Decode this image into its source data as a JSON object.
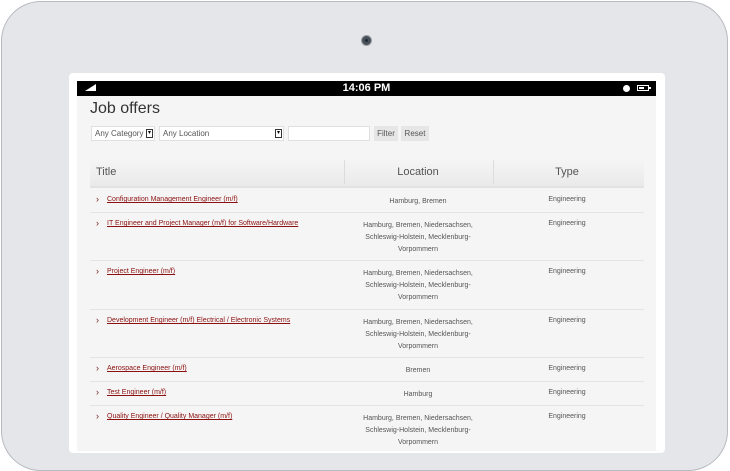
{
  "status_bar": {
    "time": "14:06 PM",
    "icons": [
      "signal-icon",
      "clock-icon",
      "battery-icon"
    ]
  },
  "page": {
    "title": "Job offers"
  },
  "filters": {
    "category_selected": "Any Category",
    "location_selected": "Any Location",
    "search_value": "",
    "filter_label": "Filter",
    "reset_label": "Reset"
  },
  "table": {
    "headers": {
      "title": "Title",
      "location": "Location",
      "type": "Type"
    },
    "rows": [
      {
        "title": "Configuration Management Engineer (m/f)",
        "location": "Hamburg, Bremen",
        "type": "Engineering"
      },
      {
        "title": "IT Engineer and Project Manager (m/f) for Software/Hardware",
        "location": "Hamburg, Bremen, Niedersachsen,\nSchleswig-Holstein, Mecklenburg-\nVorpommern",
        "type": "Engineering"
      },
      {
        "title": "Project Engineer (m/f)",
        "location": "Hamburg, Bremen, Niedersachsen,\nSchleswig-Holstein, Mecklenburg-\nVorpommern",
        "type": "Engineering"
      },
      {
        "title": "Development Engineer (m/f) Electrical / Electronic Systems",
        "location": "Hamburg, Bremen, Niedersachsen,\nSchleswig-Holstein, Mecklenburg-\nVorpommern",
        "type": "Engineering"
      },
      {
        "title": "Aerospace Engineer (m/f)",
        "location": "Bremen",
        "type": "Engineering"
      },
      {
        "title": "Test Engineer (m/f)",
        "location": "Hamburg",
        "type": "Engineering"
      },
      {
        "title": "Quality Engineer / Quality Manager (m/f)",
        "location": "Hamburg, Bremen, Niedersachsen,\nSchleswig-Holstein, Mecklenburg-\nVorpommern",
        "type": "Engineering"
      }
    ]
  },
  "colors": {
    "link": "#8b1010",
    "status_bar": "#000000",
    "device_frame": "#e4e6ea"
  }
}
